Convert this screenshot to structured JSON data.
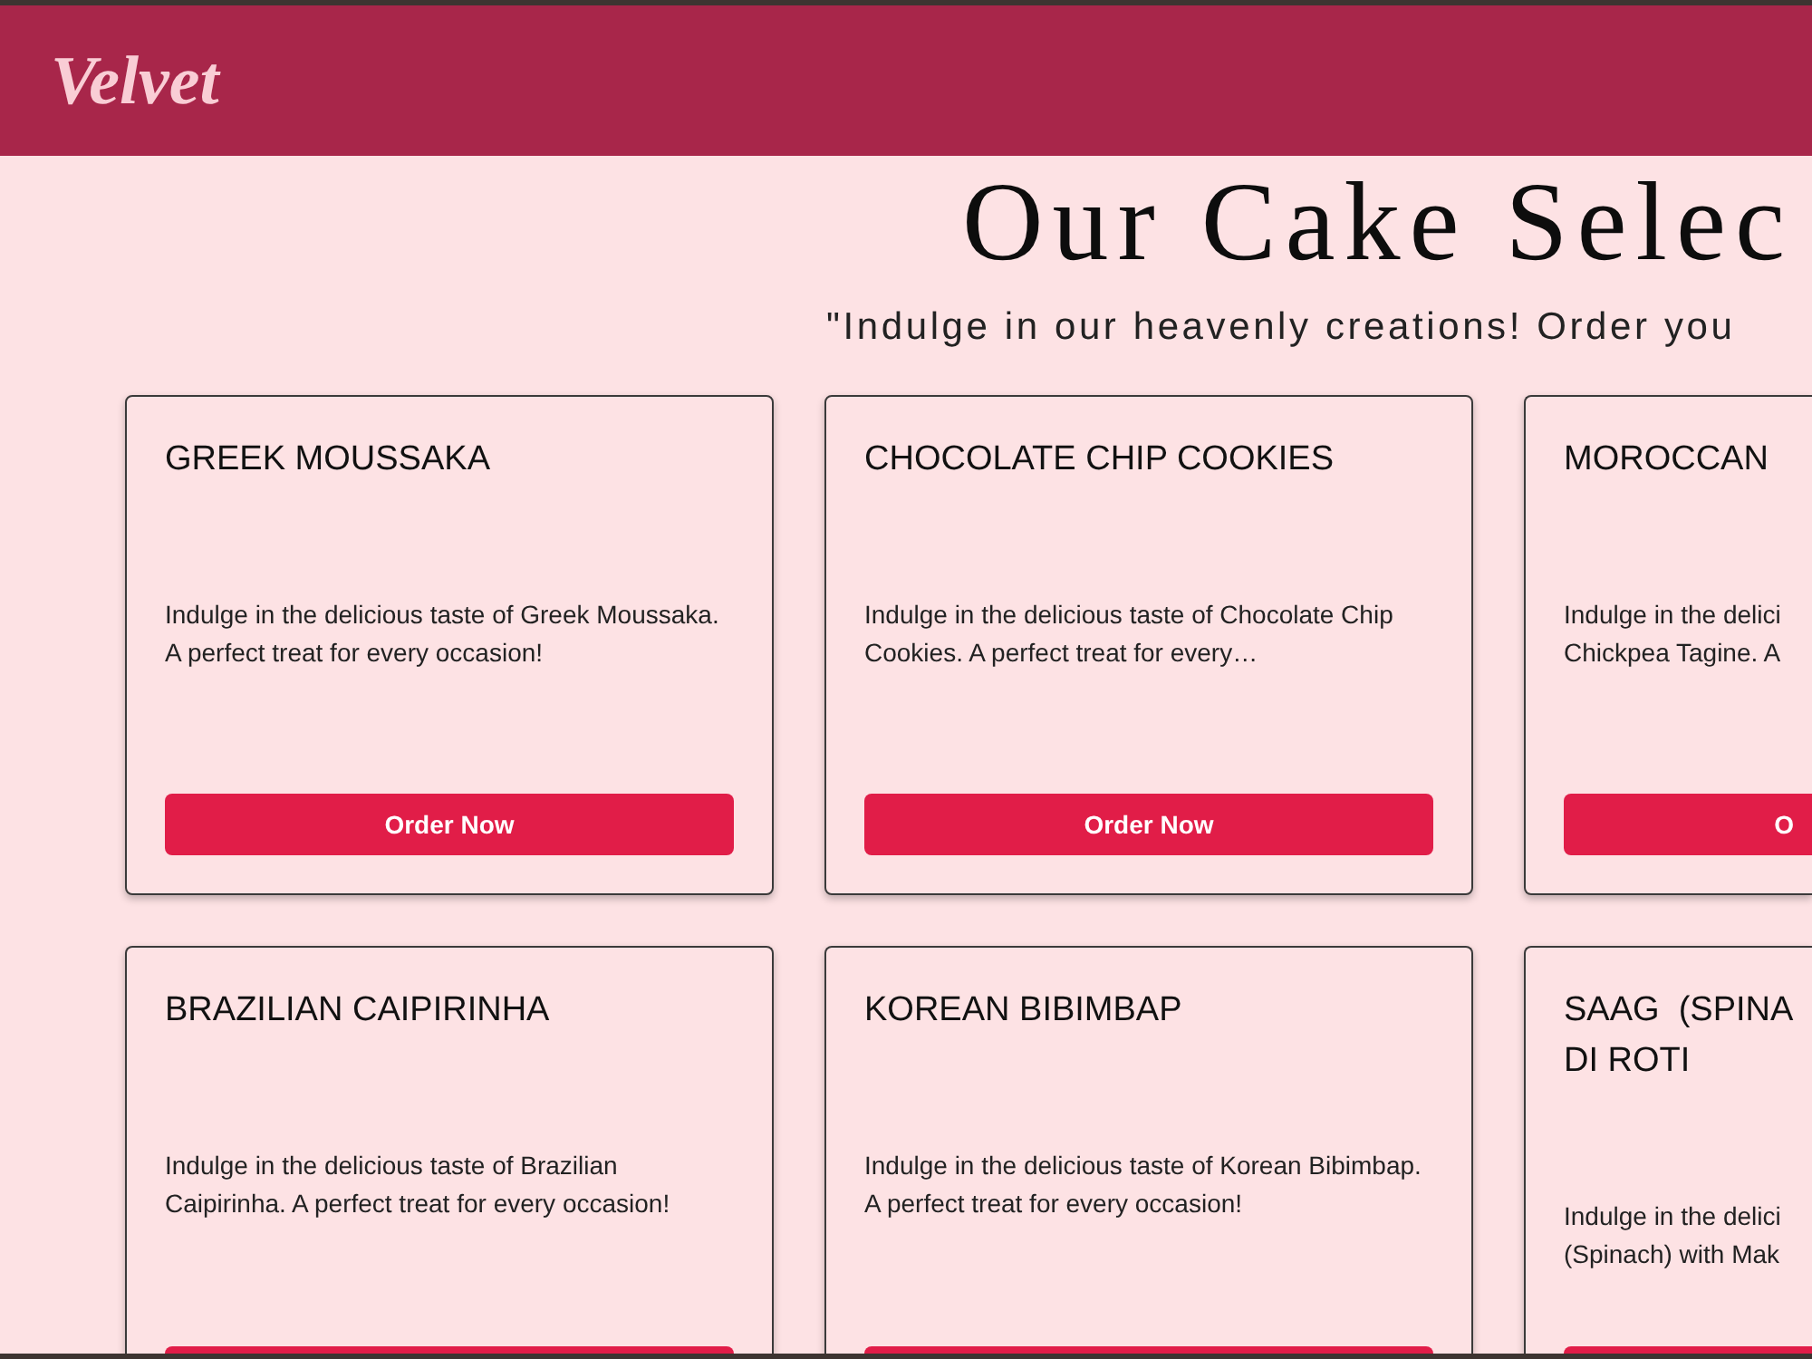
{
  "header": {
    "logo": "Velvet"
  },
  "heading": {
    "title": "Our Cake Selec",
    "subtitle": "\"Indulge in our heavenly creations! Order you"
  },
  "cards": [
    {
      "kind": "whole",
      "title": "GREEK MOUSSAKA",
      "description": "Indulge in the delicious taste of Greek Moussaka. A perfect treat for every occasion!",
      "button": "Order Now"
    },
    {
      "kind": "whole",
      "title": "CHOCOLATE CHIP COOKIES",
      "description": "Indulge in the delicious taste of Chocolate Chip Cookies. A perfect treat for every…",
      "button": "Order Now"
    },
    {
      "kind": "cut-right",
      "title": "MOROCCAN",
      "description": "Indulge in the delici\nChickpea Tagine. A",
      "button": "O"
    },
    {
      "kind": "cut-bottom",
      "title": "BRAZILIAN CAIPIRINHA",
      "description": "Indulge in the delicious taste of Brazilian Caipirinha. A perfect treat for every occasion!"
    },
    {
      "kind": "cut-bottom",
      "title": "KOREAN BIBIMBAP",
      "description": "Indulge in the delicious taste of Korean Bibimbap. A perfect treat for every occasion!"
    },
    {
      "kind": "cut-corner",
      "title": "SAAG  (SPINA\nDI ROTI",
      "description": "Indulge in the delici\n(Spinach) with Mak"
    }
  ]
}
